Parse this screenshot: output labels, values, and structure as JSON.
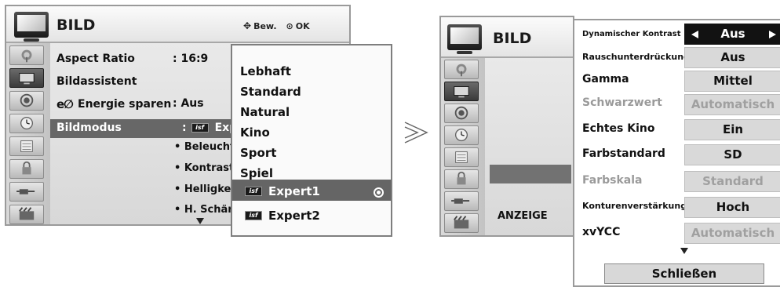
{
  "left_menu": {
    "title": "BILD",
    "hint_move": "Bew.",
    "hint_ok": "OK",
    "rows": [
      {
        "label": "Aspect Ratio",
        "value": ": 16:9"
      },
      {
        "label": "Bildassistent",
        "value": ""
      },
      {
        "label": "Energie sparen",
        "value": ": Aus"
      },
      {
        "label": "Bildmodus",
        "value": ":",
        "value_suffix": "Exp"
      }
    ],
    "sub_items": [
      "• Beleuchtu",
      "• Kontrast",
      "• Helligkeit",
      "• H. Schärf"
    ]
  },
  "dropdown": {
    "items": [
      "Lebhaft",
      "Standard",
      "Natural",
      "Kino",
      "Sport",
      "Spiel"
    ],
    "selected_label": "Expert1",
    "last_label": "Expert2",
    "badge_text": "isf"
  },
  "right_menu": {
    "title": "BILD",
    "footer_label": "ANZEIGE"
  },
  "settings": {
    "rows": [
      {
        "label": "Dynamischer Kontrast",
        "value": "Aus"
      },
      {
        "label": "Rauschunterdrückung",
        "value": "Aus"
      },
      {
        "label": "Gamma",
        "value": "Mittel"
      },
      {
        "label": "Schwarzwert",
        "value": "Automatisch"
      },
      {
        "label": "Echtes Kino",
        "value": "Ein"
      },
      {
        "label": "Farbstandard",
        "value": "SD"
      },
      {
        "label": "Farbskala",
        "value": "Standard"
      },
      {
        "label": "Konturenverstärkung",
        "value": "Hoch"
      },
      {
        "label": "xvYCC",
        "value": "Automatisch"
      }
    ],
    "close_label": "Schließen"
  },
  "colors": {
    "highlight": "#676767",
    "active_value": "#121212",
    "dim_text": "#9a9a9a"
  }
}
